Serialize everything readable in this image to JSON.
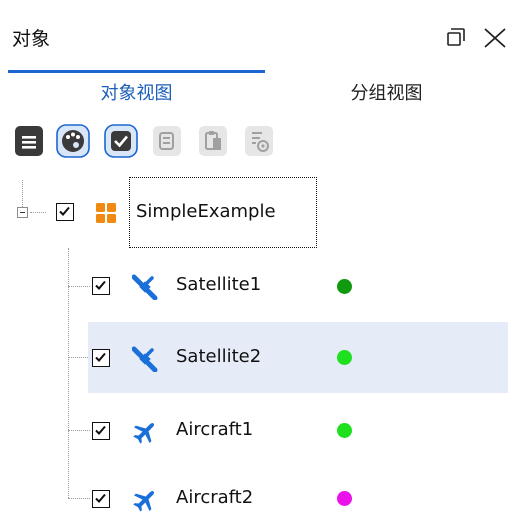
{
  "panel": {
    "title": "对象"
  },
  "tabs": [
    {
      "label": "对象视图",
      "active": true
    },
    {
      "label": "分组视图",
      "active": false
    }
  ],
  "toolbar": {
    "buttons": [
      {
        "icon": "document-icon"
      },
      {
        "icon": "palette-icon"
      },
      {
        "icon": "checkbox-icon"
      },
      {
        "icon": "copy-icon"
      },
      {
        "icon": "paste-icon"
      },
      {
        "icon": "document-settings-icon"
      }
    ]
  },
  "tree": {
    "root": {
      "label": "SimpleExample",
      "checked": true,
      "expanded": true,
      "icon": "grid-icon"
    },
    "children": [
      {
        "label": "Satellite1",
        "checked": true,
        "icon": "satellite-icon",
        "status_color": "#0f9a0f",
        "selected": false
      },
      {
        "label": "Satellite2",
        "checked": true,
        "icon": "satellite-icon",
        "status_color": "#1ee01e",
        "selected": true
      },
      {
        "label": "Aircraft1",
        "checked": true,
        "icon": "airplane-icon",
        "status_color": "#1ee01e",
        "selected": false
      },
      {
        "label": "Aircraft2",
        "checked": true,
        "icon": "airplane-icon",
        "status_color": "#ea11ea",
        "selected": false
      }
    ]
  },
  "colors": {
    "accent": "#1d66d1",
    "selection": "#e5ecf8",
    "icon_blue": "#1a6fd8",
    "icon_orange": "#f08a12"
  }
}
